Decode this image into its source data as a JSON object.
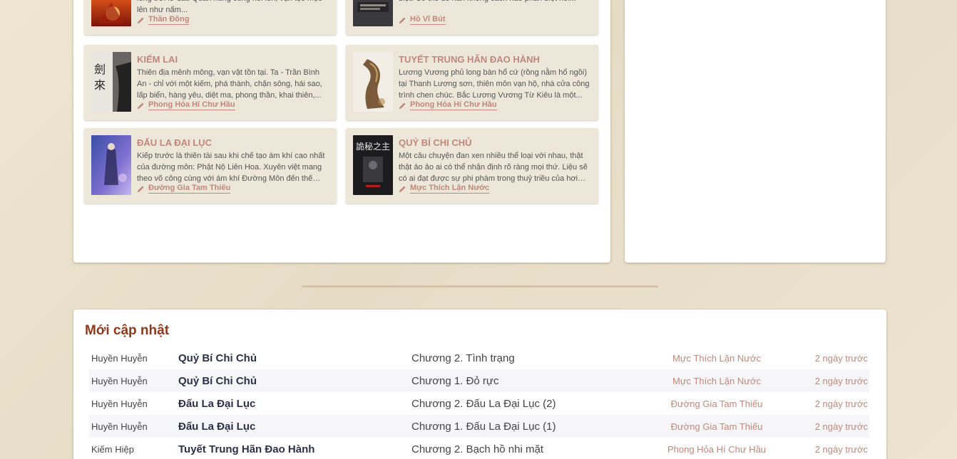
{
  "featured": {
    "cards": [
      {
        "title": "",
        "desc": "mặt trời mặt trăng và ngôi sao, trống nhây mát ở giữa long trời lở đất. Quần hùng cùng nổi lên, vạn tộc mọc lên như nấm...",
        "author": "Thần Đông"
      },
      {
        "title": "",
        "desc": "Sa vào mê vòng Lý Hoa vương không cách nào phân biệt. Có thể để hắn không cách nào phân biệt nổi...",
        "author": "Hồ Vĩ Bút"
      },
      {
        "title": "Kiếm Lai",
        "desc": "Thiên địa mênh mông, vạn vật tồn tại. Ta - Trần Bình An - chỉ với một kiếm, phá thành, chặn sông, hái sao, lấp biển, hàng yêu, diệt ma, phong thần, khai thiên,...",
        "author": "Phong Hỏa Hí Chư Hầu"
      },
      {
        "title": "Tuyết Trung Hãn Đao Hành",
        "desc": "Lương Vương phủ long bàn hổ cứ (rồng nằm hổ ngồi) tại Thanh Lương sơn, thiên môn vạn hộ, nhà cửa công trình chen chúc. Bắc Lương Vương Từ Kiêu là một...",
        "author": "Phong Hỏa Hí Chư Hầu"
      },
      {
        "title": "Đấu La Đại Lục",
        "desc": "Kiếp trước là thiên tài sau khi chế tạo ám khí cao nhất của đường môn: Phật Nộ Liên Hoa. Xuyên việt mang theo võ công cùng với ám khí Đường Môn đến thế giới...",
        "author": "Đường Gia Tam Thiếu"
      },
      {
        "title": "Quỷ Bí Chi Chủ",
        "desc": "Một câu chuyện đan xen nhiều thể loại với nhau, thật thật ảo ảo ai có thể nhận định rõ ràng mọi thứ. Liệu sẽ có ai đạt được sự phi phàm trong thuỷ triều của hơi nước...",
        "author": "Mực Thích Lặn Nước"
      }
    ]
  },
  "updates": {
    "title": "Mới cập nhật",
    "rows": [
      {
        "genre": "Huyền Huyễn",
        "book": "Quỷ Bí Chi Chủ",
        "chapter": "Chương 2. Tình trạng",
        "author": "Mực Thích Lặn Nước",
        "time": "2 ngày trước"
      },
      {
        "genre": "Huyền Huyễn",
        "book": "Quỷ Bí Chi Chủ",
        "chapter": "Chương 1. Đỏ rực",
        "author": "Mực Thích Lặn Nước",
        "time": "2 ngày trước"
      },
      {
        "genre": "Huyền Huyễn",
        "book": "Đấu La Đại Lục",
        "chapter": "Chương 2. Đấu La Đại Lục (2)",
        "author": "Đường Gia Tam Thiếu",
        "time": "2 ngày trước"
      },
      {
        "genre": "Huyền Huyễn",
        "book": "Đấu La Đại Lục",
        "chapter": "Chương 1. Đấu La Đại Lục (1)",
        "author": "Đường Gia Tam Thiếu",
        "time": "2 ngày trước"
      },
      {
        "genre": "Kiếm Hiệp",
        "book": "Tuyết Trung Hãn Đao Hành",
        "chapter": "Chương 2. Bạch hồ nhi mặt",
        "author": "Phong Hỏa Hí Chư Hầu",
        "time": "2 ngày trước"
      }
    ]
  },
  "colors": {
    "accent": "#c0877c",
    "section_title": "#8c3a1f",
    "card_bg": "#ece7d8"
  }
}
